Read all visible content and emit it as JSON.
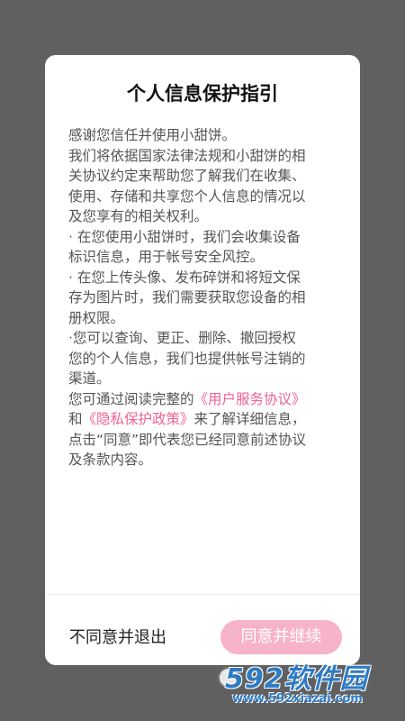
{
  "dialog": {
    "title": "个人信息保护指引",
    "content_lines": [
      "感谢您信任并使用小甜饼。",
      "我们将依据国家法律法规和小甜饼的相",
      "关协议约定来帮助您了解我们在收集、",
      "使用、存储和共享您个人信息的情况以",
      "及您享有的相关权利。",
      "· 在您使用小甜饼时，我们会收集设备",
      "标识信息，用于帐号安全风控。",
      "· 在您上传头像、发布碎饼和将短文保",
      "存为图片时，我们需要获取您设备的相",
      "册权限。",
      "·您可以查询、更正、删除、撤回授权",
      "您的个人信息，我们也提供帐号注销的",
      "渠道。"
    ],
    "link_line1_prefix": "您可通过阅读完整的",
    "link_user_agreement": "《用户服务协议》",
    "link_line2_prefix": "和",
    "link_privacy_policy": "《隐私保护政策》",
    "link_line2_suffix": "来了解详细信息，",
    "closing_lines": [
      "点击“同意”即代表您已经同意前述协议",
      "及条款内容。"
    ],
    "disagree_label": "不同意并退出",
    "agree_label": "同意并继续"
  },
  "watermark": {
    "brand": "592软件园",
    "url": "www.592xiazai.com"
  },
  "colors": {
    "overlay": "#606060",
    "link": "#f06292",
    "agree_button": "#f7b3c8",
    "watermark": "#2e7bc4"
  }
}
